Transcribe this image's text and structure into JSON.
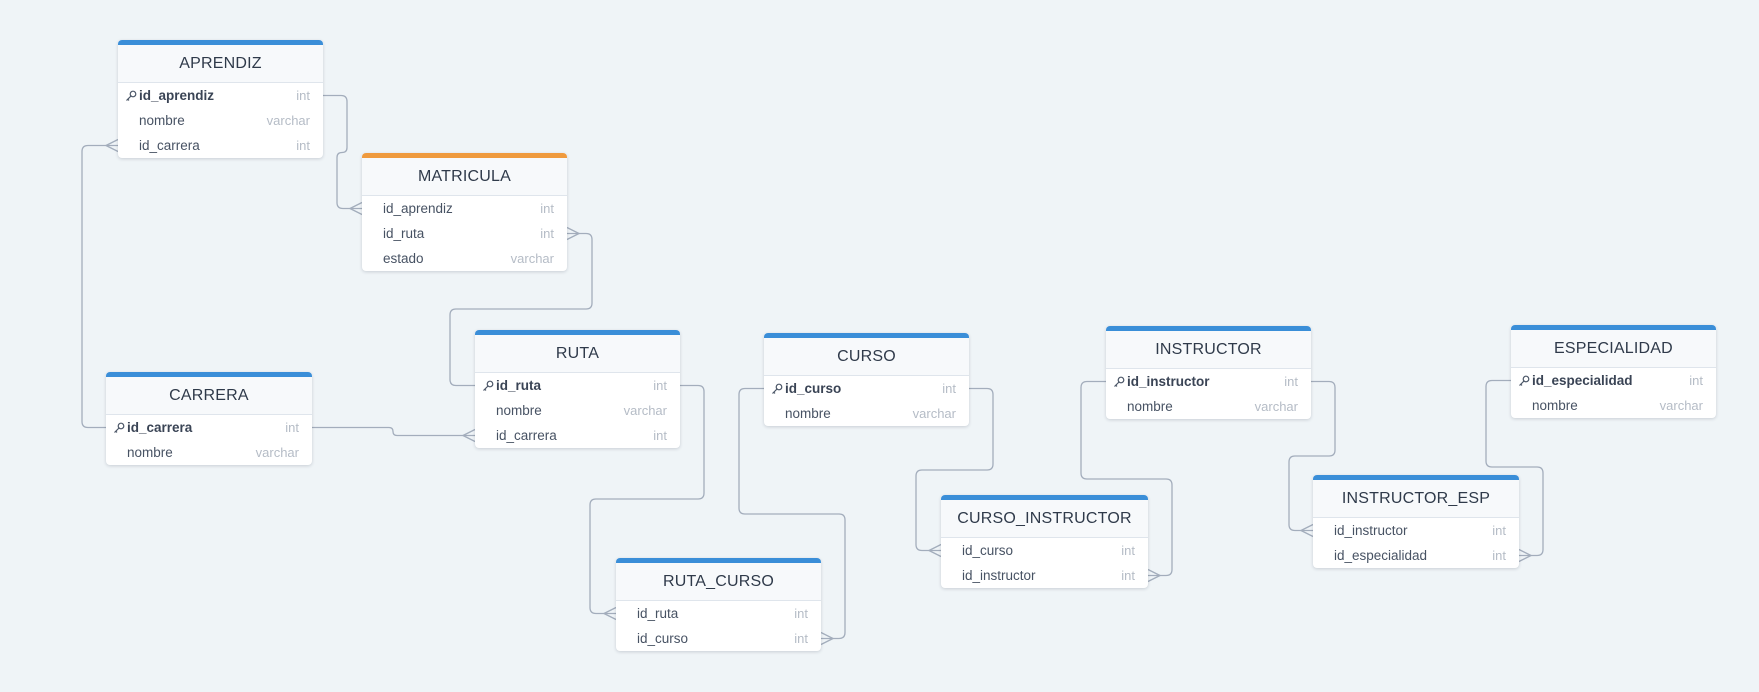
{
  "entities": {
    "aprendiz": {
      "name": "APRENDIZ",
      "fields": [
        {
          "name": "id_aprendiz",
          "type": "int",
          "pk": true
        },
        {
          "name": "nombre",
          "type": "varchar",
          "pk": false
        },
        {
          "name": "id_carrera",
          "type": "int",
          "pk": false
        }
      ]
    },
    "matricula": {
      "name": "MATRICULA",
      "accent": "#ef9a3e",
      "fields": [
        {
          "name": "id_aprendiz",
          "type": "int",
          "pk": false
        },
        {
          "name": "id_ruta",
          "type": "int",
          "pk": false
        },
        {
          "name": "estado",
          "type": "varchar",
          "pk": false
        }
      ]
    },
    "carrera": {
      "name": "CARRERA",
      "fields": [
        {
          "name": "id_carrera",
          "type": "int",
          "pk": true
        },
        {
          "name": "nombre",
          "type": "varchar",
          "pk": false
        }
      ]
    },
    "ruta": {
      "name": "RUTA",
      "fields": [
        {
          "name": "id_ruta",
          "type": "int",
          "pk": true
        },
        {
          "name": "nombre",
          "type": "varchar",
          "pk": false
        },
        {
          "name": "id_carrera",
          "type": "int",
          "pk": false
        }
      ]
    },
    "curso": {
      "name": "CURSO",
      "fields": [
        {
          "name": "id_curso",
          "type": "int",
          "pk": true
        },
        {
          "name": "nombre",
          "type": "varchar",
          "pk": false
        }
      ]
    },
    "ruta_curso": {
      "name": "RUTA_CURSO",
      "fields": [
        {
          "name": "id_ruta",
          "type": "int",
          "pk": false
        },
        {
          "name": "id_curso",
          "type": "int",
          "pk": false
        }
      ]
    },
    "instructor": {
      "name": "INSTRUCTOR",
      "fields": [
        {
          "name": "id_instructor",
          "type": "int",
          "pk": true
        },
        {
          "name": "nombre",
          "type": "varchar",
          "pk": false
        }
      ]
    },
    "curso_instructor": {
      "name": "CURSO_INSTRUCTOR",
      "fields": [
        {
          "name": "id_curso",
          "type": "int",
          "pk": false
        },
        {
          "name": "id_instructor",
          "type": "int",
          "pk": false
        }
      ]
    },
    "especialidad": {
      "name": "ESPECIALIDAD",
      "fields": [
        {
          "name": "id_especialidad",
          "type": "int",
          "pk": true
        },
        {
          "name": "nombre",
          "type": "varchar",
          "pk": false
        }
      ]
    },
    "instructor_esp": {
      "name": "INSTRUCTOR_ESP",
      "fields": [
        {
          "name": "id_instructor",
          "type": "int",
          "pk": false
        },
        {
          "name": "id_especialidad",
          "type": "int",
          "pk": false
        }
      ]
    }
  },
  "relationships": [
    {
      "from": "aprendiz.id_aprendiz",
      "to": "matricula.id_aprendiz",
      "cardinality": "one-to-many"
    },
    {
      "from": "carrera.id_carrera",
      "to": "aprendiz.id_carrera",
      "cardinality": "one-to-many"
    },
    {
      "from": "ruta.id_ruta",
      "to": "matricula.id_ruta",
      "cardinality": "one-to-many"
    },
    {
      "from": "carrera.id_carrera",
      "to": "ruta.id_carrera",
      "cardinality": "one-to-many"
    },
    {
      "from": "ruta.id_ruta",
      "to": "ruta_curso.id_ruta",
      "cardinality": "one-to-many"
    },
    {
      "from": "curso.id_curso",
      "to": "ruta_curso.id_curso",
      "cardinality": "one-to-many"
    },
    {
      "from": "curso.id_curso",
      "to": "curso_instructor.id_curso",
      "cardinality": "one-to-many"
    },
    {
      "from": "instructor.id_instructor",
      "to": "curso_instructor.id_instructor",
      "cardinality": "one-to-many"
    },
    {
      "from": "instructor.id_instructor",
      "to": "instructor_esp.id_instructor",
      "cardinality": "one-to-many"
    },
    {
      "from": "especialidad.id_especialidad",
      "to": "instructor_esp.id_especialidad",
      "cardinality": "one-to-many"
    }
  ],
  "colors": {
    "background": "#eff4f7",
    "header_accent": "#3a8ed8",
    "header_accent_alt": "#ef9a3e",
    "connector": "#a3adbc"
  }
}
